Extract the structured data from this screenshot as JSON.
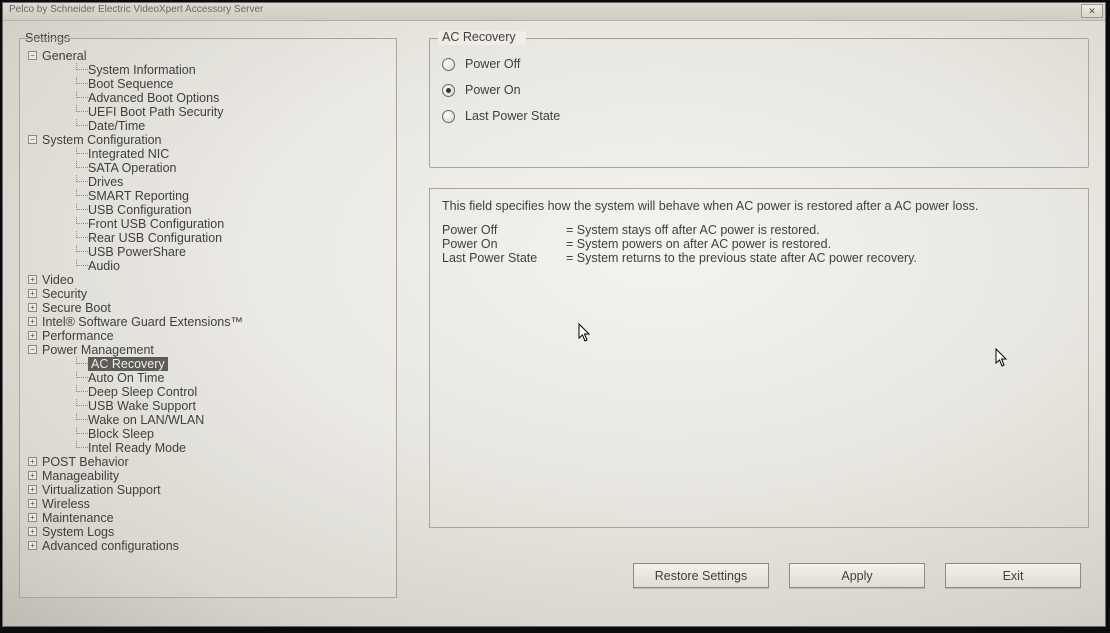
{
  "window": {
    "title": "Pelco by Schneider Electric VideoXpert Accessory Server"
  },
  "sidebar": {
    "title": "Settings",
    "tree": {
      "general": {
        "label": "General",
        "children": {
          "sysinfo": "System Information",
          "bootseq": "Boot Sequence",
          "advboot": "Advanced Boot Options",
          "uefi": "UEFI Boot Path Security",
          "datetime": "Date/Time"
        }
      },
      "sysconf": {
        "label": "System Configuration",
        "children": {
          "nic": "Integrated NIC",
          "sata": "SATA Operation",
          "drives": "Drives",
          "smart": "SMART Reporting",
          "usb": "USB Configuration",
          "fusb": "Front USB Configuration",
          "rusb": "Rear USB Configuration",
          "usbps": "USB PowerShare",
          "audio": "Audio"
        }
      },
      "video": "Video",
      "security": "Security",
      "secureboot": "Secure Boot",
      "sgx": "Intel® Software Guard Extensions™",
      "perf": "Performance",
      "power": {
        "label": "Power Management",
        "children": {
          "acrec": "AC Recovery",
          "autoon": "Auto On Time",
          "deepsleep": "Deep Sleep Control",
          "usbwake": "USB Wake Support",
          "wol": "Wake on LAN/WLAN",
          "blocksleep": "Block Sleep",
          "irmode": "Intel Ready Mode"
        }
      },
      "post": "POST Behavior",
      "manage": "Manageability",
      "virt": "Virtualization Support",
      "wireless": "Wireless",
      "maint": "Maintenance",
      "syslogs": "System Logs",
      "advconf": "Advanced configurations"
    }
  },
  "panel": {
    "group_title": "AC Recovery",
    "options": {
      "off": "Power Off",
      "on": "Power On",
      "last": "Last Power State"
    },
    "selected": "on",
    "desc_intro": "This field specifies how the system will behave when AC power is restored after a AC power loss.",
    "desc_rows": [
      {
        "k": "Power Off",
        "v": "System stays off after AC power is restored."
      },
      {
        "k": "Power On",
        "v": "System powers on after AC power is restored."
      },
      {
        "k": "Last Power State",
        "v": "System returns to the previous state after AC power recovery."
      }
    ]
  },
  "buttons": {
    "restore": "Restore Settings",
    "apply": "Apply",
    "exit": "Exit"
  }
}
